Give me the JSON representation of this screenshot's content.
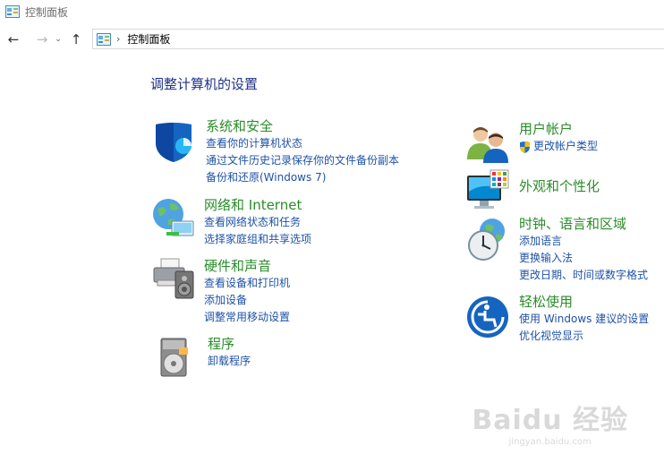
{
  "window": {
    "title": "控制面板",
    "icon": "control-panel-icon"
  },
  "nav": {
    "back": "←",
    "forward": "→",
    "history": "⌄",
    "up": "↑",
    "breadcrumb_sep": "›",
    "breadcrumb": "控制面板"
  },
  "heading": "调整计算机的设置",
  "left_categories": [
    {
      "title": "系统和安全",
      "icon": "shield-icon",
      "links": [
        "查看你的计算机状态",
        "通过文件历史记录保存你的文件备份副本",
        "备份和还原(Windows 7)"
      ]
    },
    {
      "title": "网络和 Internet",
      "icon": "globe-network-icon",
      "links": [
        "查看网络状态和任务",
        "选择家庭组和共享选项"
      ]
    },
    {
      "title": "硬件和声音",
      "icon": "printer-speaker-icon",
      "links": [
        "查看设备和打印机",
        "添加设备",
        "调整常用移动设置"
      ]
    },
    {
      "title": "程序",
      "icon": "programs-disc-icon",
      "links": [
        "卸载程序"
      ]
    }
  ],
  "right_categories": [
    {
      "title": "用户帐户",
      "icon": "users-icon",
      "links": [
        "更改帐户类型"
      ]
    },
    {
      "title": "外观和个性化",
      "icon": "monitor-palette-icon",
      "links": []
    },
    {
      "title": "时钟、语言和区域",
      "icon": "clock-globe-icon",
      "links": [
        "添加语言",
        "更换输入法",
        "更改日期、时间或数字格式"
      ]
    },
    {
      "title": "轻松使用",
      "icon": "accessibility-icon",
      "links": [
        "使用 Windows 建议的设置",
        "优化视觉显示"
      ]
    }
  ],
  "watermark": {
    "logo": "Baidu 经验",
    "sub": "jingyan.baidu.com"
  },
  "colors": {
    "heading": "#1e3287",
    "category": "#2a8c2a",
    "link": "#1e52a7"
  }
}
